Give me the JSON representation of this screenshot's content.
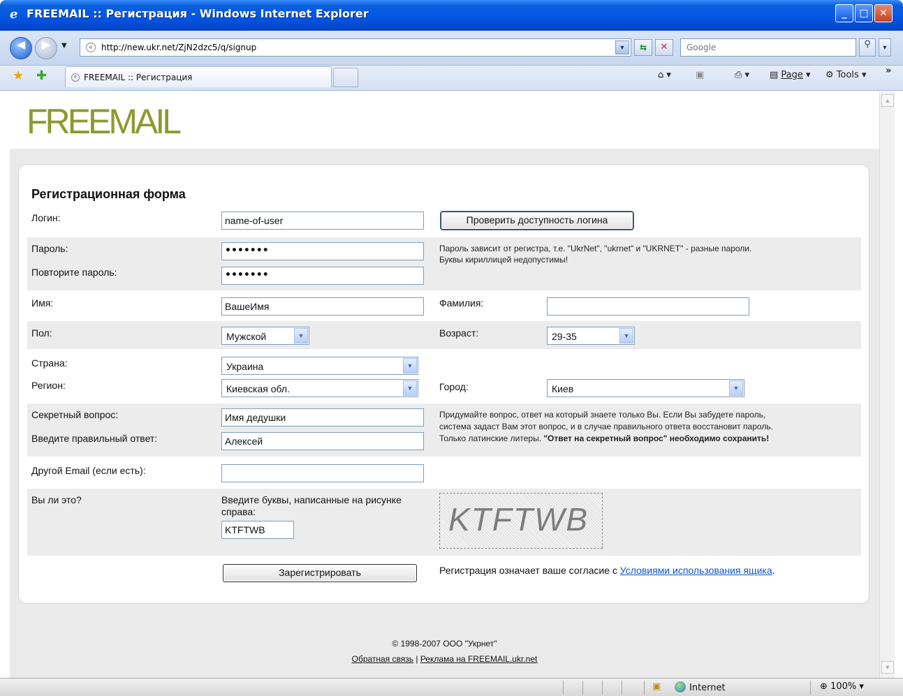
{
  "window": {
    "title": "FREEMAIL :: Регистрация - Windows Internet Explorer"
  },
  "browser": {
    "url": "http://new.ukr.net/ZjN2dzc5/q/signup",
    "search_placeholder": "Google",
    "tab_title": "FREEMAIL :: Регистрация",
    "page_menu": "Page",
    "tools_menu": "Tools",
    "status_zone": "Internet",
    "zoom": "100%"
  },
  "page": {
    "logo": "FREEMAIL",
    "form_title": "Регистрационная форма",
    "login": {
      "label": "Логин:",
      "value": "name-of-user",
      "check_button": "Проверить доступность логина"
    },
    "password": {
      "label": "Пароль:",
      "repeat_label": "Повторите пароль:",
      "masked": "•••••••",
      "repeat_masked": "•••••••",
      "note_line1": "Пароль зависит от регистра, т.е. \"UkrNet\", \"ukrnet\" и \"UKRNET\" - разные пароли.",
      "note_line2": "Буквы кириллицей недопустимы!"
    },
    "name": {
      "first_label": "Имя:",
      "first_value": "ВашеИмя",
      "last_label": "Фамилия:",
      "last_value": ""
    },
    "gender": {
      "label": "Пол:",
      "value": "Мужской",
      "age_label": "Возраст:",
      "age_value": "29-35"
    },
    "location": {
      "country_label": "Страна:",
      "country_value": "Украина",
      "region_label": "Регион:",
      "region_value": "Киевская обл.",
      "city_label": "Город:",
      "city_value": "Киев"
    },
    "secret": {
      "question_label": "Секретный вопрос:",
      "question_value": "Имя дедушки",
      "answer_label": "Введите правильный ответ:",
      "answer_value": "Алексей",
      "note_line1": "Придумайте вопрос, ответ на который знаете только Вы. Если Вы забудете пароль,",
      "note_line2": "система задаст Вам этот вопрос, и в случае правильного ответа восстановит пароль.",
      "note_line3_plain": "Только латинские литеры. ",
      "note_line3_bold": "\"Ответ на секретный вопрос\" необходимо сохранить!"
    },
    "other_email": {
      "label": "Другой Email (если есть):",
      "value": ""
    },
    "captcha": {
      "label": "Вы ли это?",
      "instruction_line1": "Введите буквы, написанные на рисунке",
      "instruction_line2": "справа:",
      "value": "KTFTWB",
      "image_text": "KTFTWB"
    },
    "register": {
      "button": "Зарегистрировать",
      "agreement_text": "Регистрация означает ваше согласие с ",
      "agreement_link": "Условиями использования ящика",
      "agreement_end": "."
    },
    "footer": {
      "copyright": "© 1998-2007 ООО \"Укрнет\"",
      "feedback_link": "Обратная связь",
      "separator": " | ",
      "ads_link": "Реклама на FREEMAIL.ukr.net"
    }
  }
}
